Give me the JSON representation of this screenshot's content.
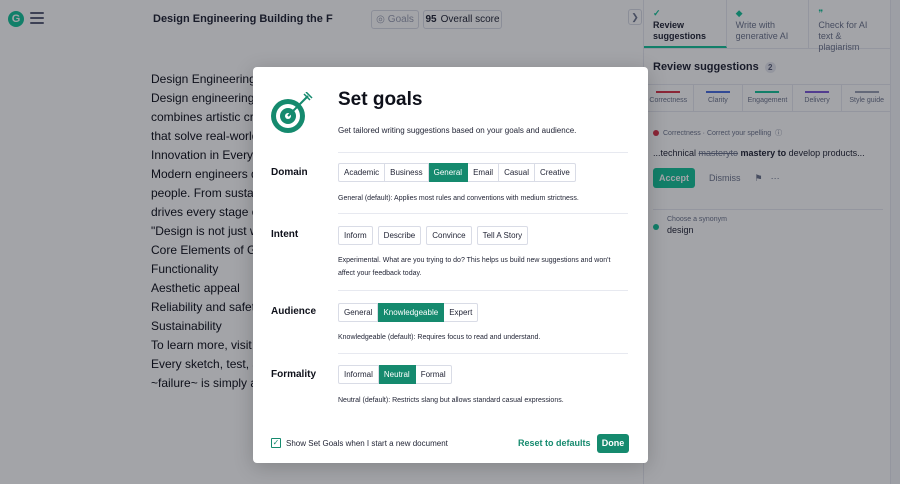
{
  "editor": {
    "logo_letter": "G",
    "doc_title": "Design Engineering Building the Futur...",
    "goals_label": "Goals",
    "score_value": "95",
    "score_label": "Overall score",
    "collapse_glyph": "❯",
    "lines": [
      "Design Engineering: B",
      "Design engineering is",
      "combines artistic cre",
      "that solve real-world",
      "Innovation in Every D",
      "Modern engineers do",
      "people. From sustain",
      "drives every stage of",
      "\"Design is not just wh",
      "Core Elements of Gre",
      "Functionality",
      "Aesthetic appeal",
      "Reliability and safety",
      "Sustainability",
      "To learn more, visit E",
      "Every sketch, test, an",
      "~failure~ is simply an"
    ]
  },
  "panel": {
    "tabs": [
      {
        "label": "Review suggestions",
        "icon": "✓"
      },
      {
        "label": "Write with generative AI",
        "icon": "◆"
      },
      {
        "label": "Check for AI text & plagiarism",
        "icon": "❞"
      }
    ],
    "section_title": "Review suggestions",
    "section_count": "2",
    "categories": [
      {
        "label": "Correctness",
        "color": "#d8344a"
      },
      {
        "label": "Clarity",
        "color": "#4a6ee0"
      },
      {
        "label": "Engagement",
        "color": "#15c39a"
      },
      {
        "label": "Delivery",
        "color": "#7c5ad9"
      },
      {
        "label": "Style guide",
        "color": "#9aa0b3"
      }
    ],
    "card": {
      "head": "Correctness · Correct your spelling",
      "info_glyph": "ⓘ",
      "prefix": "...technical ",
      "wrong": "masteryto",
      "right": " mastery to",
      "suffix": " develop products...",
      "accept": "Accept",
      "dismiss": "Dismiss",
      "flag_glyph": "⚑",
      "more_glyph": "⋯"
    },
    "synonym": {
      "hint": "Choose a synonym",
      "word": "design"
    }
  },
  "modal": {
    "title": "Set goals",
    "subtitle": "Get tailored writing suggestions based on your goals and audience.",
    "sections": {
      "domain": {
        "label": "Domain",
        "options": [
          "Academic",
          "Business",
          "General",
          "Email",
          "Casual",
          "Creative"
        ],
        "selected": "General",
        "desc": "General (default): Applies most rules and conventions with medium strictness."
      },
      "intent": {
        "label": "Intent",
        "options": [
          "Inform",
          "Describe",
          "Convince",
          "Tell A Story"
        ],
        "desc": "Experimental. What are you trying to do? This helps us build new suggestions and won't affect your feedback today."
      },
      "audience": {
        "label": "Audience",
        "options": [
          "General",
          "Knowledgeable",
          "Expert"
        ],
        "selected": "Knowledgeable",
        "desc": "Knowledgeable (default): Requires focus to read and understand."
      },
      "formality": {
        "label": "Formality",
        "options": [
          "Informal",
          "Neutral",
          "Formal"
        ],
        "selected": "Neutral",
        "desc": "Neutral (default): Restricts slang but allows standard casual expressions."
      }
    },
    "checkbox_label": "Show Set Goals when I start a new document",
    "checkbox_checked": true,
    "reset_label": "Reset to defaults",
    "done_label": "Done"
  },
  "colors": {
    "brand": "#15c39a",
    "selected": "#158a6e",
    "overlay": "rgba(14,16,26,0.38)"
  }
}
